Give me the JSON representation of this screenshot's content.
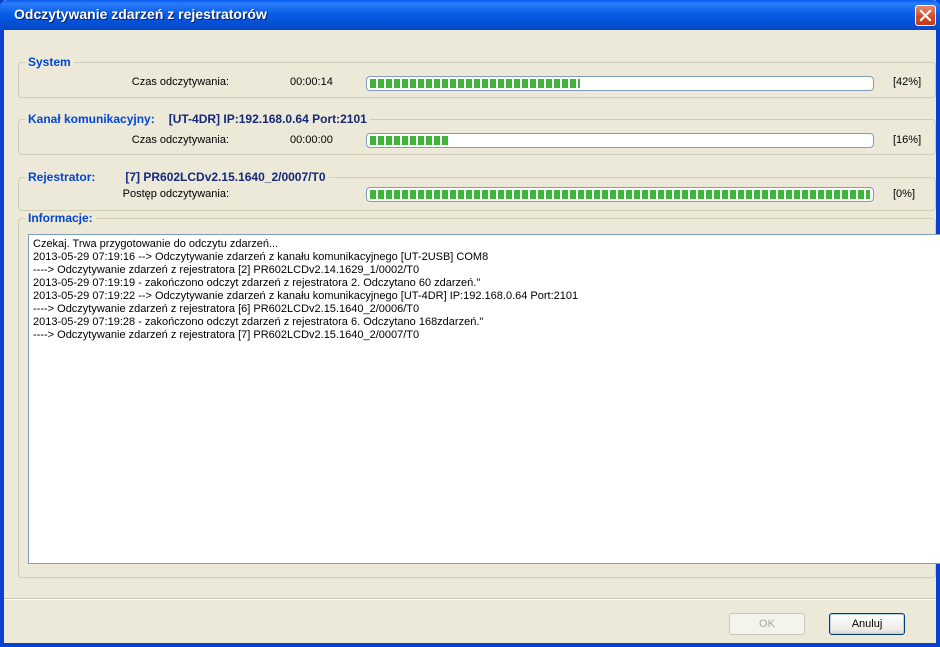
{
  "window": {
    "title": "Odczytywanie zdarzeń z rejestratorów",
    "title_bar_color": "#0a5ee6"
  },
  "system": {
    "legend": "System",
    "label": "Czas odczytywania:",
    "time": "00:00:14",
    "progress": 0.42,
    "percent_text": "[42%]"
  },
  "channel": {
    "legend": "Kanał komunikacyjny:",
    "info": "[UT-4DR] IP:192.168.0.64  Port:2101",
    "label": "Czas odczytywania:",
    "time": "00:00:00",
    "progress": 0.16,
    "percent_text": "[16%]"
  },
  "recorder": {
    "legend": "Rejestrator:",
    "info": "[7] PR602LCDv2.15.1640_2/0007/T0",
    "label": "Postęp odczytywania:",
    "progress": 1.0,
    "percent_text": "[0%]"
  },
  "info": {
    "legend": "Informacje:",
    "lines": [
      "Czekaj. Trwa przygotowanie do odczytu zdarzeń...",
      "2013-05-29 07:19:16 --> Odczytywanie zdarzeń z kanału komunikacyjnego [UT-2USB] COM8",
      "----> Odczytywanie zdarzeń z rejestratora [2] PR602LCDv2.14.1629_1/0002/T0",
      "2013-05-29 07:19:19  - zakończono odczyt zdarzeń z rejestratora 2. Odczytano 60 zdarzeń.\"",
      "2013-05-29 07:19:22 --> Odczytywanie zdarzeń z kanału komunikacyjnego [UT-4DR] IP:192.168.0.64  Port:2101",
      "----> Odczytywanie zdarzeń z rejestratora [6] PR602LCDv2.15.1640_2/0006/T0",
      "2013-05-29 07:19:28  - zakończono odczyt zdarzeń z rejestratora 6. Odczytano 168zdarzeń.\"",
      "----> Odczytywanie zdarzeń z rejestratora [7] PR602LCDv2.15.1640_2/0007/T0"
    ]
  },
  "buttons": {
    "ok": "OK",
    "cancel": "Anuluj"
  },
  "colors": {
    "progress_fill": "#3fb43a",
    "legend_text": "#0046d5"
  }
}
